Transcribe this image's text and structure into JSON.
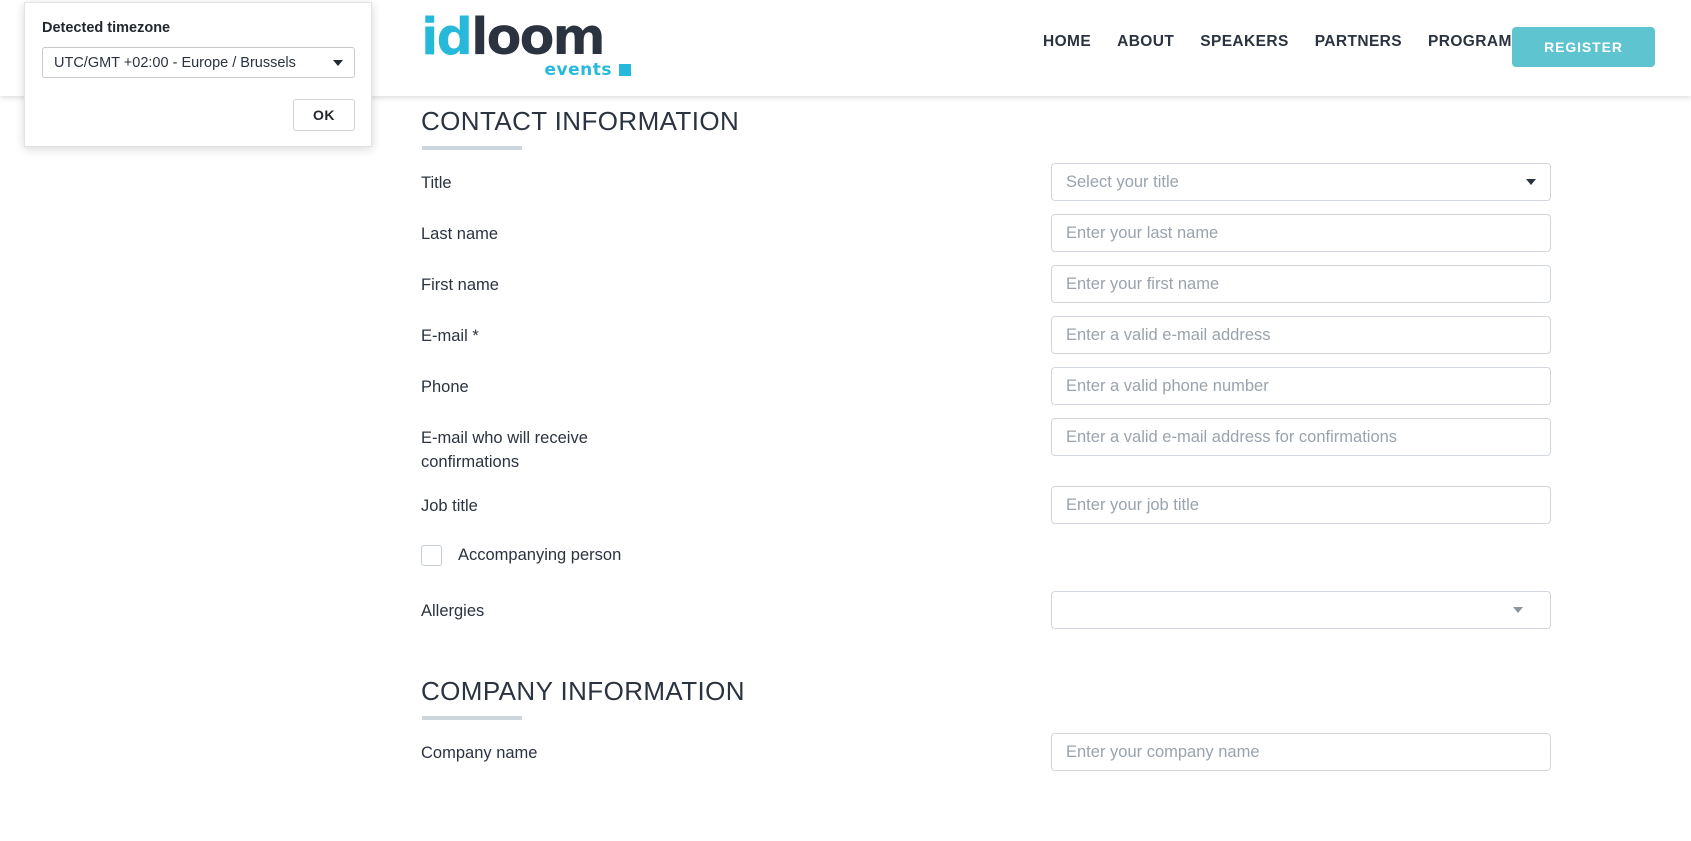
{
  "header": {
    "logo": {
      "part1": "id",
      "part2": "loom",
      "subtitle": "events",
      "color_primary": "#27b9da",
      "color_secondary": "#2b3340"
    },
    "nav_items": [
      {
        "label": "HOME"
      },
      {
        "label": "ABOUT"
      },
      {
        "label": "SPEAKERS"
      },
      {
        "label": "PARTNERS"
      },
      {
        "label": "PROGRAMME"
      }
    ],
    "register_button": {
      "label": "REGISTER",
      "color": "#5ec4d0"
    }
  },
  "timezone_dialog": {
    "title": "Detected timezone",
    "selected_value": "UTC/GMT +02:00 - Europe / Brussels",
    "ok_label": "OK"
  },
  "sections": [
    {
      "heading": "CONTACT INFORMATION",
      "fields": [
        {
          "label": "Title",
          "type": "select",
          "value": "Select your title",
          "is_placeholder": true
        },
        {
          "label": "Last name",
          "type": "text",
          "placeholder": "Enter your last name",
          "value": ""
        },
        {
          "label": "First name",
          "type": "text",
          "placeholder": "Enter your first name",
          "value": ""
        },
        {
          "label": "E-mail *",
          "type": "text",
          "placeholder": "Enter a valid e-mail address",
          "value": ""
        },
        {
          "label": "Phone",
          "type": "text",
          "placeholder": "Enter a valid phone number",
          "value": ""
        },
        {
          "label": "E-mail who will receive confirmations",
          "type": "text",
          "placeholder": "Enter a valid e-mail address for confirmations",
          "value": ""
        },
        {
          "label": "Job title",
          "type": "text",
          "placeholder": "Enter your job title",
          "value": ""
        },
        {
          "label": "Accompanying person",
          "type": "checkbox",
          "checked": false
        },
        {
          "label": "Allergies",
          "type": "select",
          "value": "",
          "is_placeholder": false
        }
      ]
    },
    {
      "heading": "COMPANY INFORMATION",
      "fields": [
        {
          "label": "Company name",
          "type": "text",
          "placeholder": "Enter your company name",
          "value": ""
        }
      ]
    }
  ]
}
